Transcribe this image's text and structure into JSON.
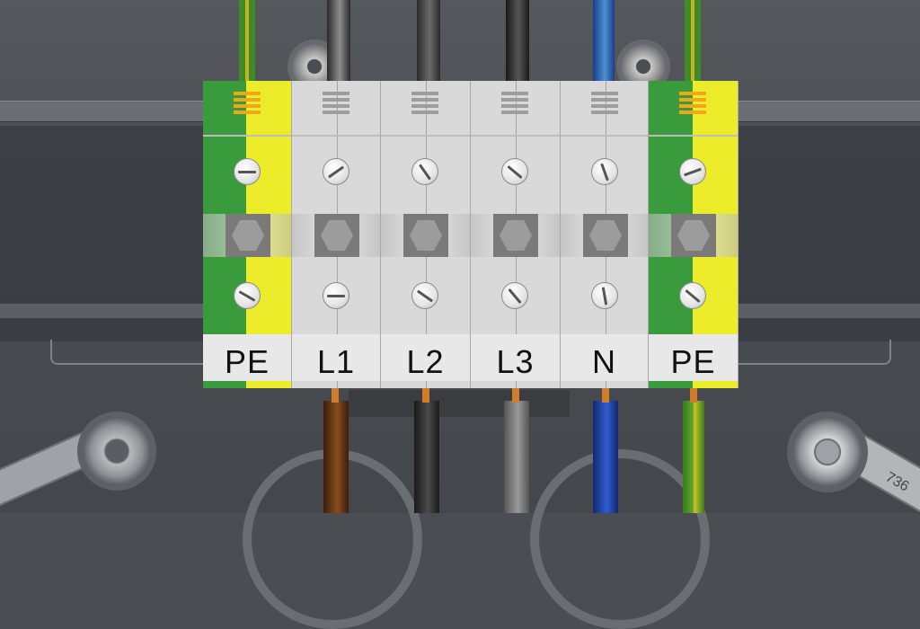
{
  "terminals": [
    {
      "label": "PE",
      "type": "earth"
    },
    {
      "label": "L1",
      "type": "phase"
    },
    {
      "label": "L2",
      "type": "phase"
    },
    {
      "label": "L3",
      "type": "phase"
    },
    {
      "label": "N",
      "type": "neutral"
    },
    {
      "label": "PE",
      "type": "earth"
    }
  ],
  "cable_label": "736",
  "colors": {
    "background": "#4a4d52",
    "terminal_grey": "#d9d9d9",
    "earth_green": "#3a9b3c",
    "earth_yellow": "#ecec2a",
    "wire_brown": "#6b3a16",
    "wire_black": "#2e2e2e",
    "wire_grey": "#7a7a7a",
    "wire_blue": "#2a4fb8",
    "wire_green_yellow": "#5a9a2c"
  }
}
